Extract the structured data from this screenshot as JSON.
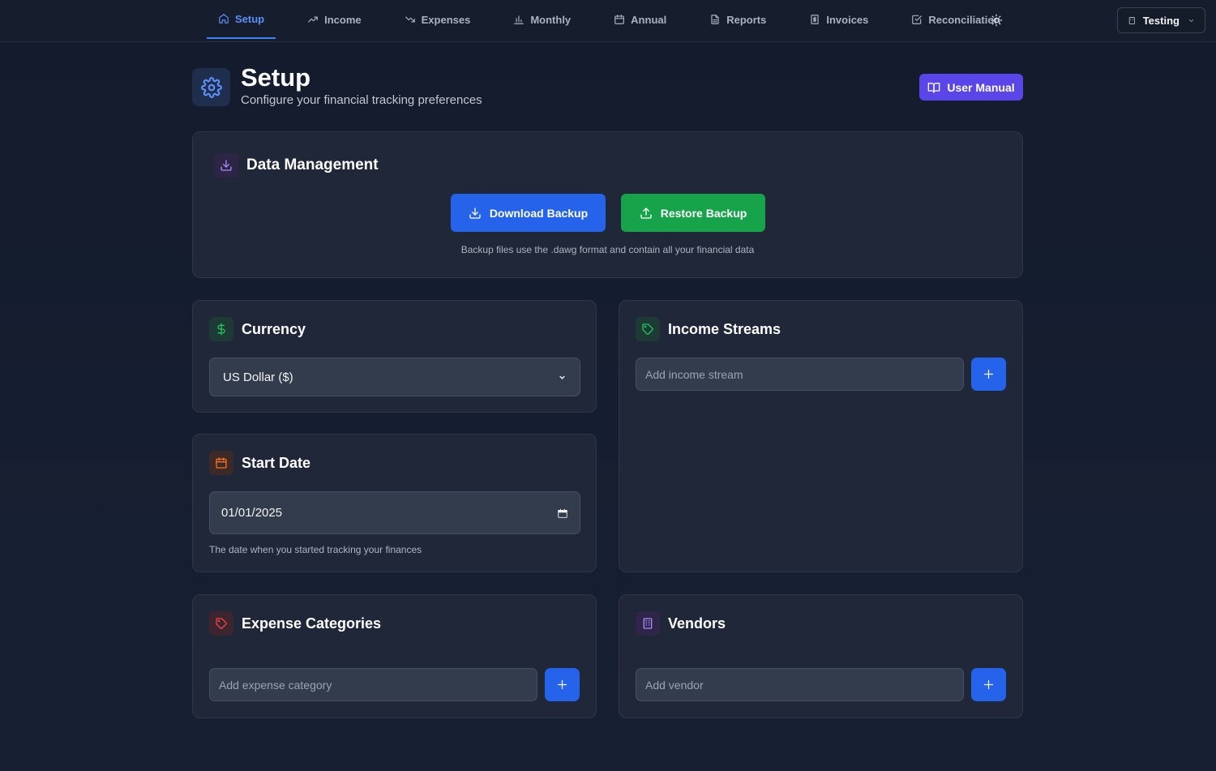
{
  "nav": {
    "tabs": [
      {
        "label": "Setup",
        "icon": "home-icon",
        "active": true
      },
      {
        "label": "Income",
        "icon": "trending-up-icon"
      },
      {
        "label": "Expenses",
        "icon": "trending-down-icon"
      },
      {
        "label": "Monthly",
        "icon": "bar-chart-icon"
      },
      {
        "label": "Annual",
        "icon": "calendar-icon"
      },
      {
        "label": "Reports",
        "icon": "file-text-icon"
      },
      {
        "label": "Invoices",
        "icon": "receipt-icon"
      },
      {
        "label": "Reconciliation",
        "icon": "check-square-icon"
      }
    ],
    "theme_icon": "sun-icon",
    "workspace": {
      "label": "Testing",
      "icon": "building-icon"
    }
  },
  "header": {
    "title": "Setup",
    "subtitle": "Configure your financial tracking preferences",
    "manual_label": "User Manual"
  },
  "data_management": {
    "title": "Data Management",
    "download_label": "Download Backup",
    "restore_label": "Restore Backup",
    "hint": "Backup files use the .dawg format and contain all your financial data"
  },
  "currency": {
    "title": "Currency",
    "selected": "US Dollar ($)"
  },
  "start_date": {
    "title": "Start Date",
    "value": "01/01/2025",
    "hint": "The date when you started tracking your finances"
  },
  "income_streams": {
    "title": "Income Streams",
    "placeholder": "Add income stream"
  },
  "expense_categories": {
    "title": "Expense Categories",
    "placeholder": "Add expense category"
  },
  "vendors": {
    "title": "Vendors",
    "placeholder": "Add vendor"
  },
  "colors": {
    "accent_blue": "#2563eb",
    "accent_green": "#16a34a",
    "accent_purple": "#5a45e8",
    "background": "#131b2c"
  }
}
